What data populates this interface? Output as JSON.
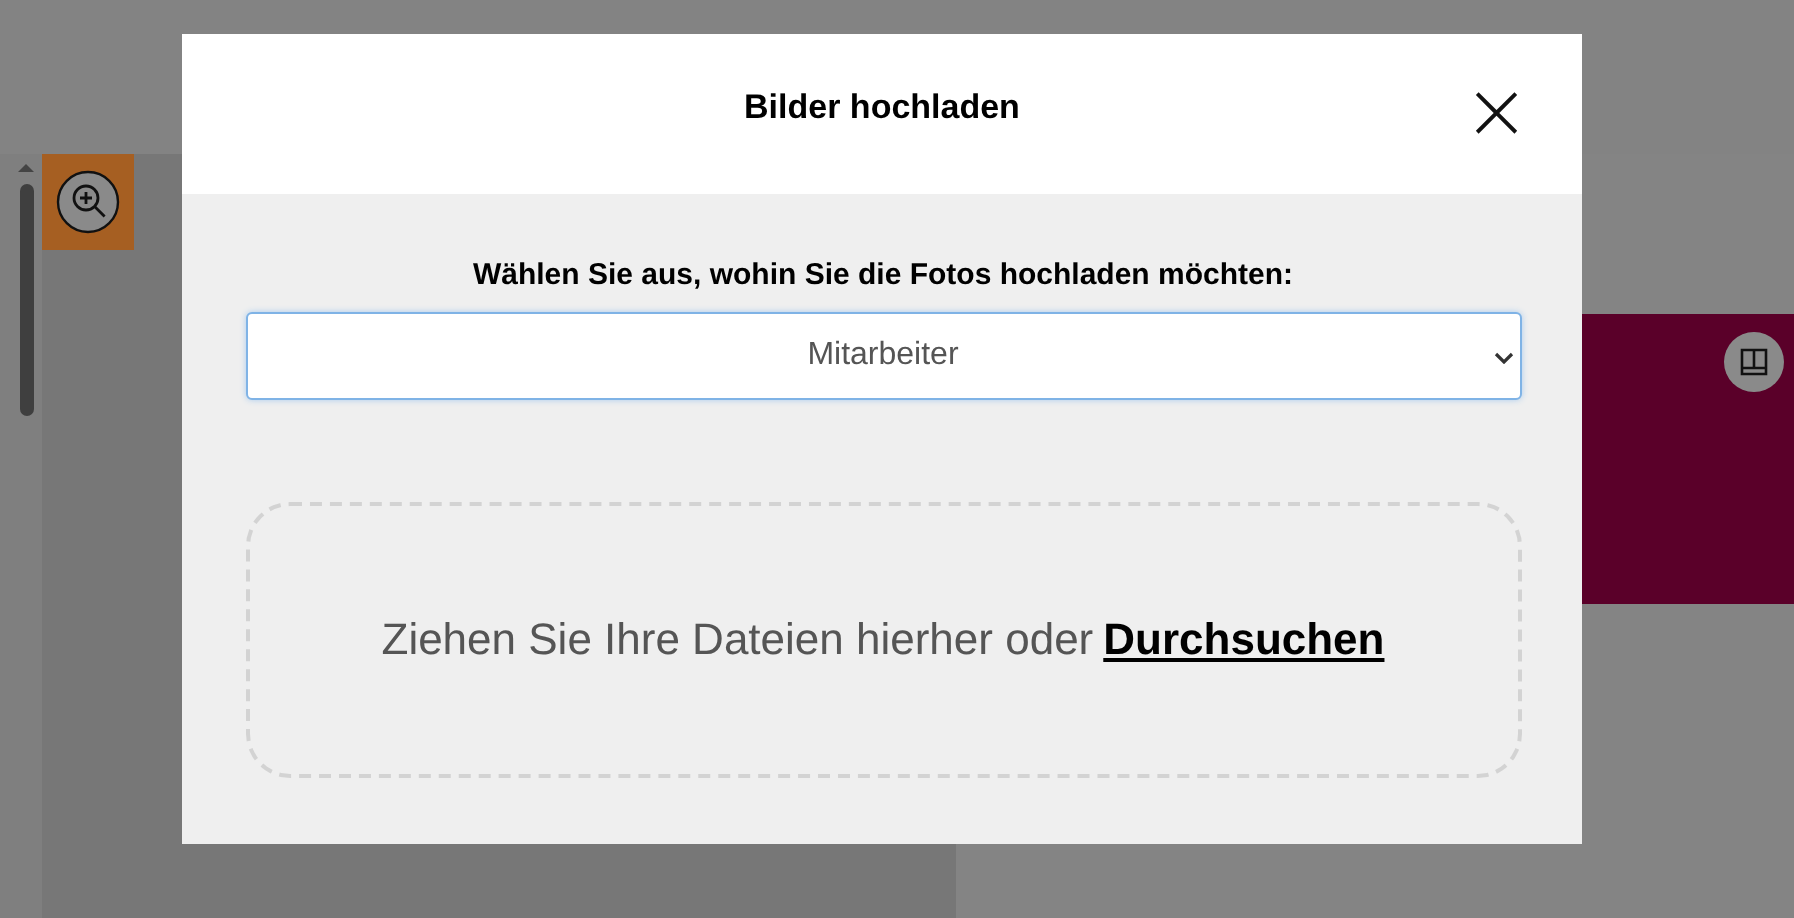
{
  "dialog": {
    "title": "Bilder hochladen",
    "close": "×",
    "prompt": "Wählen Sie aus, wohin Sie die Fotos hochladen möchten:",
    "destination": {
      "value": "Mitarbeiter"
    },
    "dropzone": {
      "text": "Ziehen Sie Ihre Dateien hierher oder",
      "link": "Durchsuchen"
    }
  }
}
